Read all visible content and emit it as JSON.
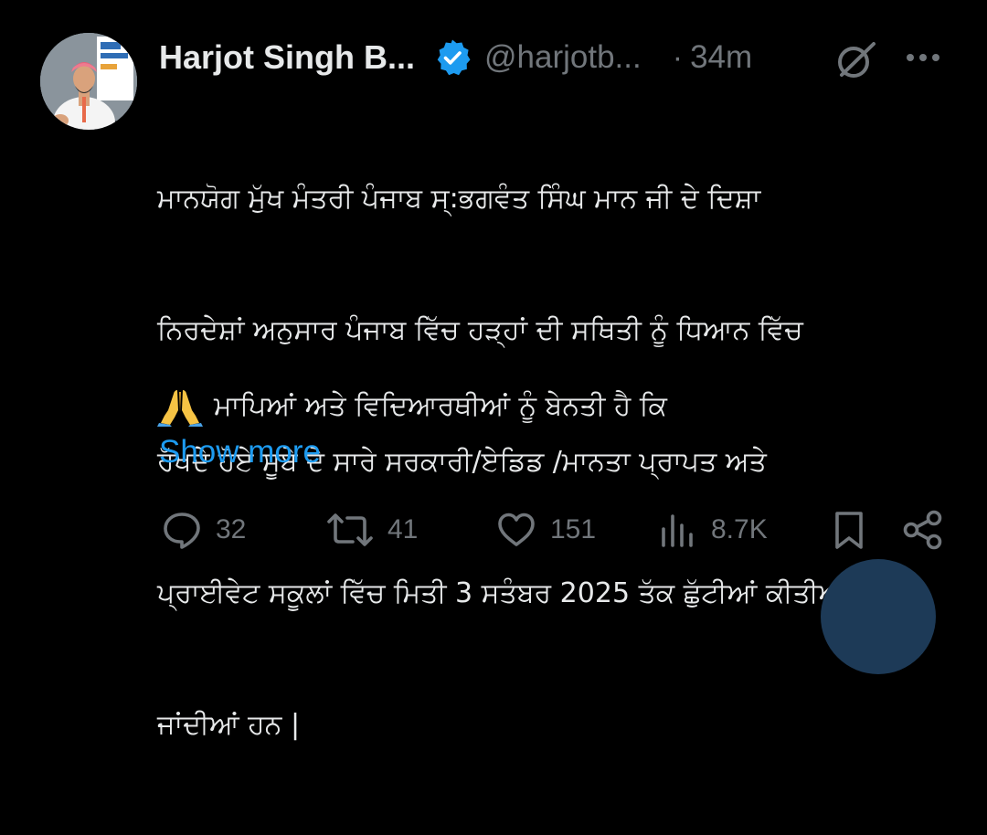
{
  "author": {
    "name": "Harjot Singh B...",
    "handle": "@harjotb...",
    "separator": "·",
    "time": "34m"
  },
  "icons": {
    "verified": "verified-badge-icon",
    "grok": "grok-icon",
    "more": "more-dots-icon",
    "pray": "folded-hands-icon",
    "reply": "reply-bubble-icon",
    "repost": "repost-icon",
    "like": "heart-icon",
    "views": "views-bar-chart-icon",
    "bookmark": "bookmark-icon",
    "share": "share-icon"
  },
  "tweet": {
    "lines": [
      "ਮਾਨਯੋਗ ਮੁੱਖ ਮੰਤਰੀ ਪੰਜਾਬ ਸ੍:ਭਗਵੰਤ ਸਿੰਘ ਮਾਨ ਜੀ ਦੇ ਦਿਸ਼ਾ",
      "ਨਿਰਦੇਸ਼ਾਂ ਅਨੁਸਾਰ ਪੰਜਾਬ ਵਿੱਚ ਹੜ੍ਹਾਂ ਦੀ ਸਥਿਤੀ ਨੂੰ ਧਿਆਨ ਵਿੱਚ",
      "ਰੱਖਦੇ ਹੋਏ ਸੂਬੇ ਦੇ ਸਾਰੇ ਸਰਕਾਰੀ/ਏਡਿਡ /ਮਾਨਤਾ ਪ੍ਰਾਪਤ ਅਤੇ",
      "ਪ੍ਰਾਈਵੇਟ ਸਕੂਲਾਂ ਵਿੱਚ ਮਿਤੀ 3 ਸਤੰਬਰ 2025 ਤੱਕ ਛੁੱਟੀਆਂ ਕੀਤੀਆਂ",
      "ਜਾਂਦੀਆਂ ਹਨ |"
    ],
    "second_paragraph": "ਮਾਪਿਆਂ ਅਤੇ ਵਿਦਿਆਰਥੀਆਂ ਨੂੰ ਬੇਨਤੀ ਹੈ ਕਿ",
    "show_more": "Show more"
  },
  "actions": {
    "replies": "32",
    "reposts": "41",
    "likes": "151",
    "views": "8.7K"
  },
  "colors": {
    "background": "#000000",
    "text": "#e7e9ea",
    "muted": "#71767b",
    "accent": "#1d9bf0"
  }
}
